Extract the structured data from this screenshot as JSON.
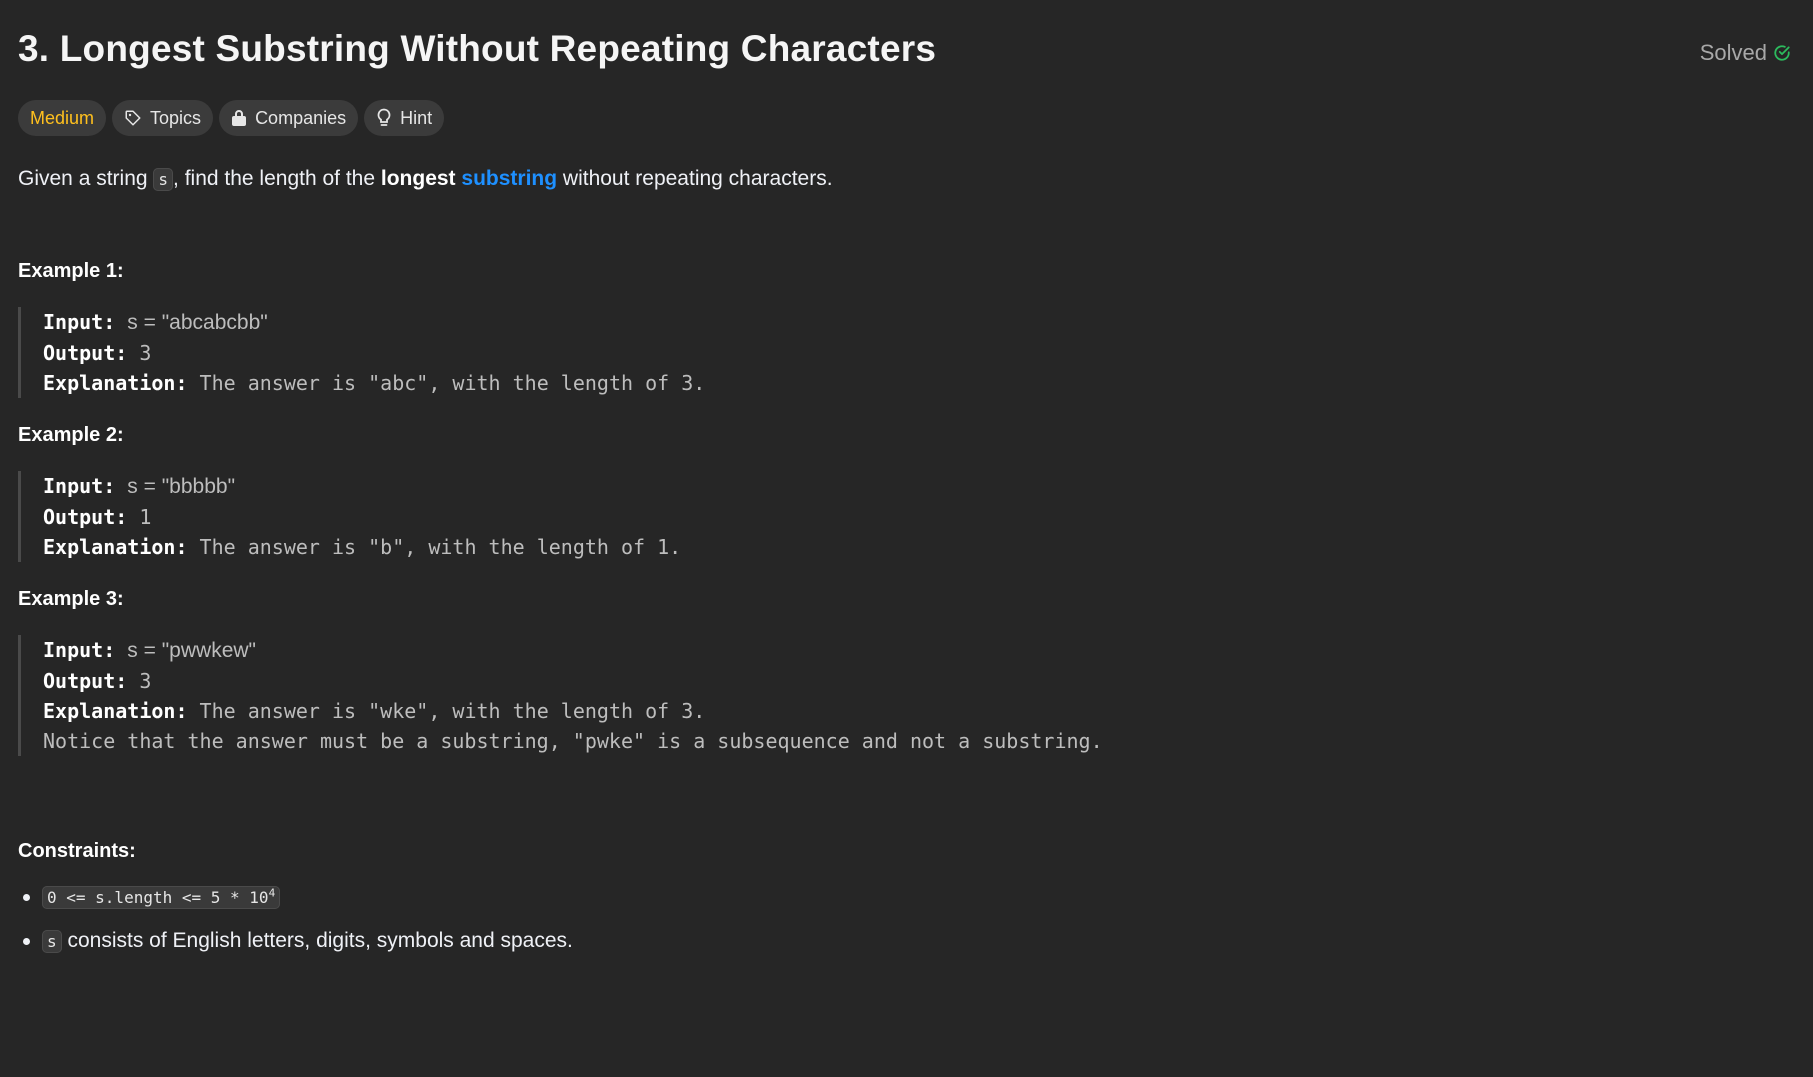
{
  "problem": {
    "title": "3. Longest Substring Without Repeating Characters",
    "status": "Solved"
  },
  "tags": {
    "difficulty": "Medium",
    "topics": "Topics",
    "companies": "Companies",
    "hint": "Hint"
  },
  "description": {
    "part1": "Given a string ",
    "var": "s",
    "part2": ", find the length of the ",
    "bold": "longest",
    "space": " ",
    "link": "substring",
    "part3": " without repeating characters."
  },
  "examples": [
    {
      "title": "Example 1:",
      "input_label": "Input:",
      "input": "s = \"abcabcbb\"",
      "output_label": "Output:",
      "output": "3",
      "explanation_label": "Explanation:",
      "explanation": "The answer is \"abc\", with the length of 3."
    },
    {
      "title": "Example 2:",
      "input_label": "Input:",
      "input": "s = \"bbbbb\"",
      "output_label": "Output:",
      "output": "1",
      "explanation_label": "Explanation:",
      "explanation": "The answer is \"b\", with the length of 1."
    },
    {
      "title": "Example 3:",
      "input_label": "Input:",
      "input": "s = \"pwwkew\"",
      "output_label": "Output:",
      "output": "3",
      "explanation_label": "Explanation:",
      "explanation": "The answer is \"wke\", with the length of 3.",
      "note": "Notice that the answer must be a substring, \"pwke\" is a subsequence and not a substring."
    }
  ],
  "constraints": {
    "title": "Constraints:",
    "c1_code": "0 <= s.length <= 5 * 10",
    "c1_sup": "4",
    "c2_code": "s",
    "c2_text": " consists of English letters, digits, symbols and spaces."
  },
  "colors": {
    "background": "#262626",
    "medium": "#ffc01e",
    "link": "#1e90ff",
    "solved_check": "#2cbb5d"
  }
}
